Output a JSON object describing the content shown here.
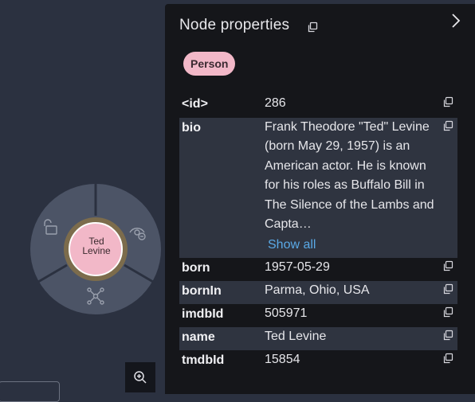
{
  "canvas": {
    "node": {
      "label_line1": "Ted",
      "label_line2": "Levine",
      "color": "#f2b8c8"
    },
    "radial_menu": [
      {
        "icon": "unlock-icon"
      },
      {
        "icon": "hide-eye-icon"
      },
      {
        "icon": "expand-network-icon"
      }
    ],
    "zoom_icon": "zoom-in-icon"
  },
  "panel": {
    "title": "Node properties",
    "label_badge": "Person",
    "badge_color": "#f2b8c8",
    "properties": [
      {
        "key": "<id>",
        "value": "286"
      },
      {
        "key": "bio",
        "value": "Frank Theodore \"Ted\" Levine (born May 29, 1957) is an American actor.  He is known for his roles as Buffalo Bill in The Silence of the Lambs and Capta…",
        "show_all": "Show all"
      },
      {
        "key": "born",
        "value": "1957-05-29"
      },
      {
        "key": "bornIn",
        "value": "Parma, Ohio, USA"
      },
      {
        "key": "imdbId",
        "value": "505971"
      },
      {
        "key": "name",
        "value": "Ted Levine"
      },
      {
        "key": "tmdbId",
        "value": "15854"
      }
    ]
  }
}
